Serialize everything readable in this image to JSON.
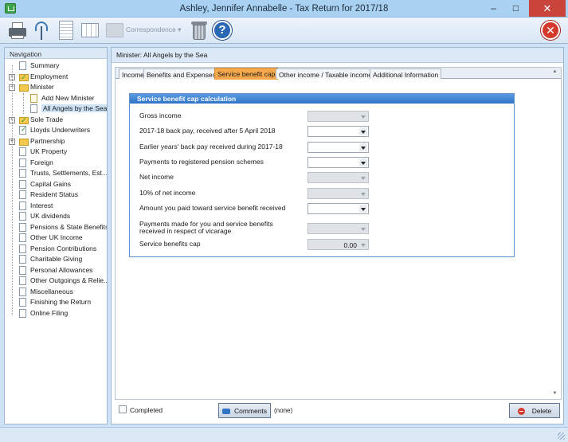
{
  "window": {
    "title": "Ashley, Jennifer Annabelle - Tax Return for 2017/18",
    "minimize": "–",
    "maximize": "□",
    "close": "✕"
  },
  "toolbar": {
    "correspondence_label": "Correspondence ▾",
    "help_glyph": "?",
    "exit_glyph": "✕"
  },
  "navigation": {
    "header": "Navigation",
    "items": [
      {
        "label": "Summary",
        "level": 1,
        "icon": "doc",
        "expander": ""
      },
      {
        "label": "Employment",
        "level": 1,
        "icon": "check-folder",
        "expander": "+"
      },
      {
        "label": "Minister",
        "level": 1,
        "icon": "folder-open",
        "expander": "−"
      },
      {
        "label": "Add New Minister",
        "level": 2,
        "icon": "new-doc",
        "expander": ""
      },
      {
        "label": "All Angels by the Sea",
        "level": 2,
        "icon": "doc",
        "expander": "",
        "selected": true
      },
      {
        "label": "Sole Trade",
        "level": 1,
        "icon": "check-folder",
        "expander": "+"
      },
      {
        "label": "Lloyds Underwriters",
        "level": 1,
        "icon": "check-doc",
        "expander": ""
      },
      {
        "label": "Partnership",
        "level": 1,
        "icon": "folder",
        "expander": "+"
      },
      {
        "label": "UK Property",
        "level": 1,
        "icon": "doc",
        "expander": ""
      },
      {
        "label": "Foreign",
        "level": 1,
        "icon": "doc",
        "expander": ""
      },
      {
        "label": "Trusts, Settlements, Est...",
        "level": 1,
        "icon": "doc",
        "expander": ""
      },
      {
        "label": "Capital Gains",
        "level": 1,
        "icon": "doc",
        "expander": ""
      },
      {
        "label": "Resident Status",
        "level": 1,
        "icon": "doc",
        "expander": ""
      },
      {
        "label": "Interest",
        "level": 1,
        "icon": "doc",
        "expander": ""
      },
      {
        "label": "UK dividends",
        "level": 1,
        "icon": "doc",
        "expander": ""
      },
      {
        "label": "Pensions & State Benefits",
        "level": 1,
        "icon": "doc",
        "expander": ""
      },
      {
        "label": "Other UK Income",
        "level": 1,
        "icon": "doc",
        "expander": ""
      },
      {
        "label": "Pension Contributions",
        "level": 1,
        "icon": "doc",
        "expander": ""
      },
      {
        "label": "Charitable Giving",
        "level": 1,
        "icon": "doc",
        "expander": ""
      },
      {
        "label": "Personal Allowances",
        "level": 1,
        "icon": "doc",
        "expander": ""
      },
      {
        "label": "Other Outgoings & Relie...",
        "level": 1,
        "icon": "doc",
        "expander": ""
      },
      {
        "label": "Miscellaneous",
        "level": 1,
        "icon": "doc",
        "expander": ""
      },
      {
        "label": "Finishing the Return",
        "level": 1,
        "icon": "doc",
        "expander": ""
      },
      {
        "label": "Online Filing",
        "level": 1,
        "icon": "doc",
        "expander": ""
      }
    ]
  },
  "main": {
    "breadcrumb": "Minister: All Angels by the Sea",
    "tabs": [
      {
        "label": "Income",
        "active": false
      },
      {
        "label": "Benefits and Expenses",
        "active": false
      },
      {
        "label": "Service benefit cap",
        "active": true
      },
      {
        "label": "Other income / Taxable income",
        "active": false
      },
      {
        "label": "Additional Information",
        "active": false
      }
    ],
    "panel": {
      "title": "Service benefit cap calculation",
      "fields": [
        {
          "label": "Gross income",
          "value": "",
          "enabled": false
        },
        {
          "label": "2017-18 back pay, received after 5 April 2018",
          "value": "",
          "enabled": true
        },
        {
          "label": "Earlier years' back pay received during 2017-18",
          "value": "",
          "enabled": true
        },
        {
          "label": "Payments to registered pension schemes",
          "value": "",
          "enabled": true
        },
        {
          "label": "Net income",
          "value": "",
          "enabled": false
        },
        {
          "label": "10% of net income",
          "value": "",
          "enabled": false
        },
        {
          "label": "Amount you paid toward service benefit received",
          "value": "",
          "enabled": true
        },
        {
          "label": "Payments made for you and service benefits received in respect of vicarage",
          "value": "",
          "enabled": false
        },
        {
          "label": "Service benefits cap",
          "value": "0.00",
          "enabled": false
        }
      ]
    }
  },
  "footer": {
    "completed_label": "Completed",
    "comments_label": "Comments",
    "comments_status": "(none)",
    "delete_label": "Delete"
  },
  "scrollbar": {
    "up": "▲",
    "down": "▼"
  }
}
